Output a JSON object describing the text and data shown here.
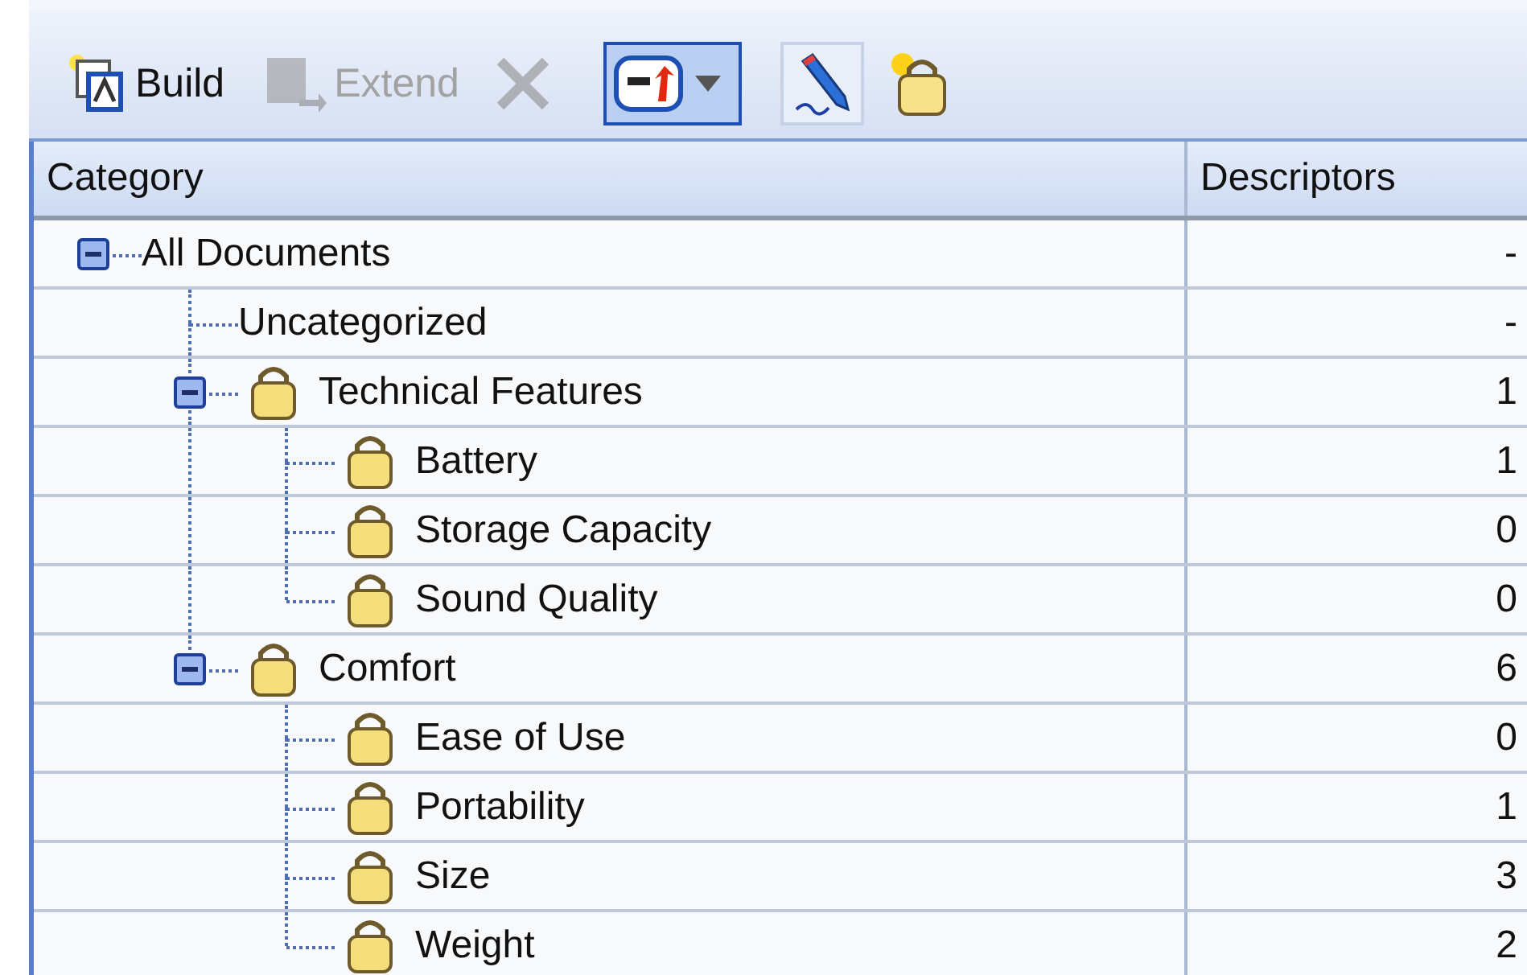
{
  "toolbar": [
    {
      "kind": "build",
      "label": "Build",
      "disabled": false,
      "pressed": false
    },
    {
      "kind": "extend",
      "label": "Extend",
      "disabled": true,
      "pressed": false
    },
    {
      "kind": "delete",
      "disabled": true,
      "pressed": false
    },
    {
      "kind": "view-menu",
      "disabled": false,
      "pressed": true
    },
    {
      "kind": "edit",
      "disabled": false,
      "pressed": true
    },
    {
      "kind": "new-category",
      "disabled": false,
      "pressed": false
    }
  ],
  "table": {
    "columns": [
      "Category",
      "Descriptors"
    ],
    "tree": [
      {
        "kind": "plain",
        "category": "All Documents",
        "descriptors": "-",
        "expanded": true,
        "children": [
          {
            "kind": "plain",
            "category": "Uncategorized",
            "descriptors": "-"
          },
          {
            "kind": "category",
            "category": "Technical Features",
            "descriptors": "1",
            "expanded": true,
            "children": [
              {
                "kind": "category",
                "category": "Battery",
                "descriptors": "1"
              },
              {
                "kind": "category",
                "category": "Storage Capacity",
                "descriptors": "0"
              },
              {
                "kind": "category",
                "category": "Sound Quality",
                "descriptors": "0"
              }
            ]
          },
          {
            "kind": "category",
            "category": "Comfort",
            "descriptors": "6",
            "expanded": true,
            "children": [
              {
                "kind": "category",
                "category": "Ease of Use",
                "descriptors": "0"
              },
              {
                "kind": "category",
                "category": "Portability",
                "descriptors": "1"
              },
              {
                "kind": "category",
                "category": "Size",
                "descriptors": "3"
              },
              {
                "kind": "category",
                "category": "Weight",
                "descriptors": "2"
              }
            ]
          }
        ]
      }
    ]
  }
}
